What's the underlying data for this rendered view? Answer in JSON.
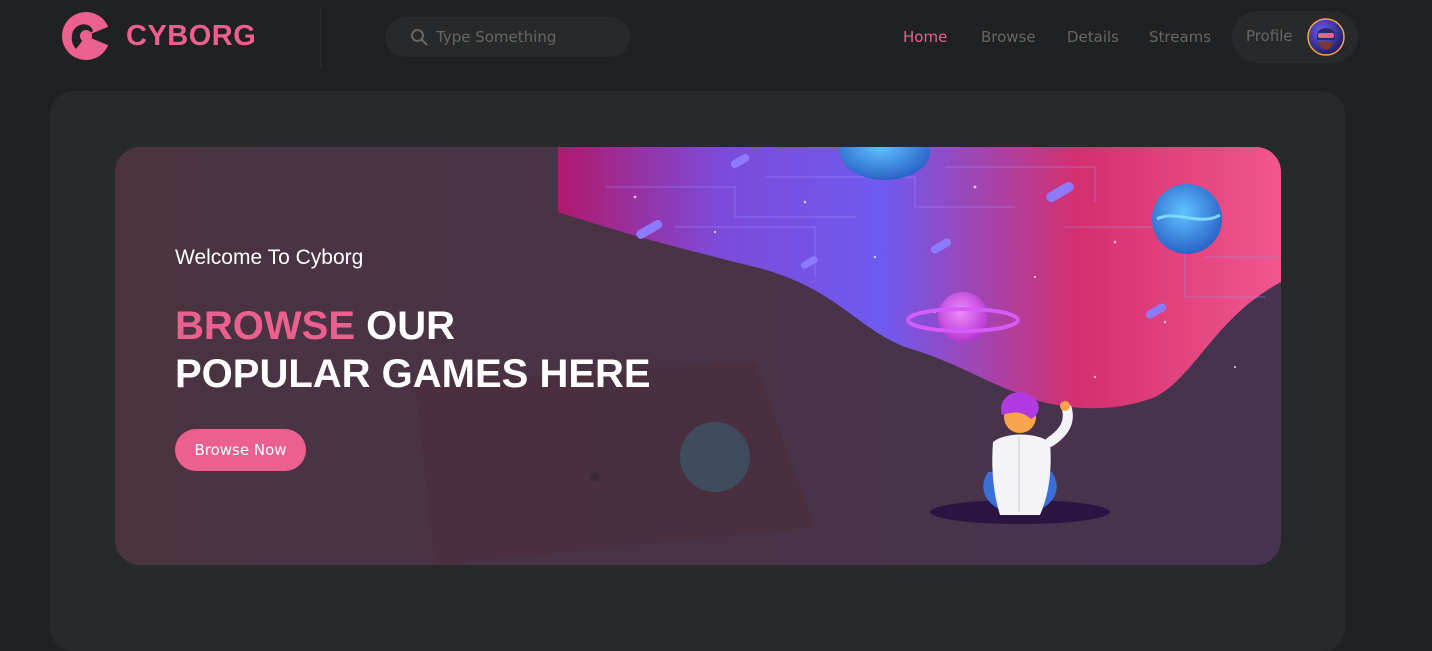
{
  "brand": {
    "name": "CYBORG",
    "accent": "#ec6090"
  },
  "search": {
    "placeholder": "Type Something"
  },
  "nav": [
    {
      "label": "Home",
      "active": true
    },
    {
      "label": "Browse",
      "active": false
    },
    {
      "label": "Details",
      "active": false
    },
    {
      "label": "Streams",
      "active": false
    }
  ],
  "profile": {
    "label": "Profile"
  },
  "banner": {
    "welcome": "Welcome To Cyborg",
    "headline_accent": "BROWSE",
    "headline_rest_1": "OUR",
    "headline_rest_2": "POPULAR GAMES HERE",
    "button_label": "Browse Now"
  },
  "icons": {
    "search": "search-icon",
    "logo": "logo-icon",
    "avatar": "avatar"
  }
}
